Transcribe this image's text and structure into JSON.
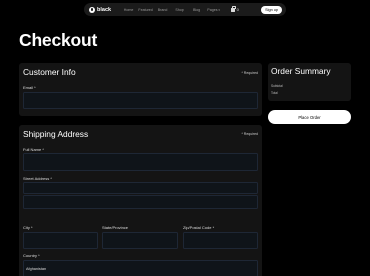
{
  "nav": {
    "brand": "black",
    "links": [
      "Home",
      "Featured",
      "Brand",
      "Shop",
      "Blog",
      "Pages"
    ],
    "cart_count": "0",
    "signup_label": "Sign up"
  },
  "page": {
    "title": "Checkout"
  },
  "customer_info": {
    "title": "Customer Info",
    "required_note": "* Required",
    "email_label": "Email *",
    "email_value": ""
  },
  "shipping": {
    "title": "Shipping Address",
    "required_note": "* Required",
    "full_name_label": "Full Name *",
    "street_label": "Street Address *",
    "city_label": "City *",
    "state_label": "State/Province",
    "zip_label": "Zip/Postal Code *",
    "country_label": "Country *",
    "country_value": "Afghanistan"
  },
  "summary": {
    "title": "Order Summary",
    "subtotal_label": "Subtotal",
    "total_label": "Total",
    "place_order_label": "Place Order"
  }
}
